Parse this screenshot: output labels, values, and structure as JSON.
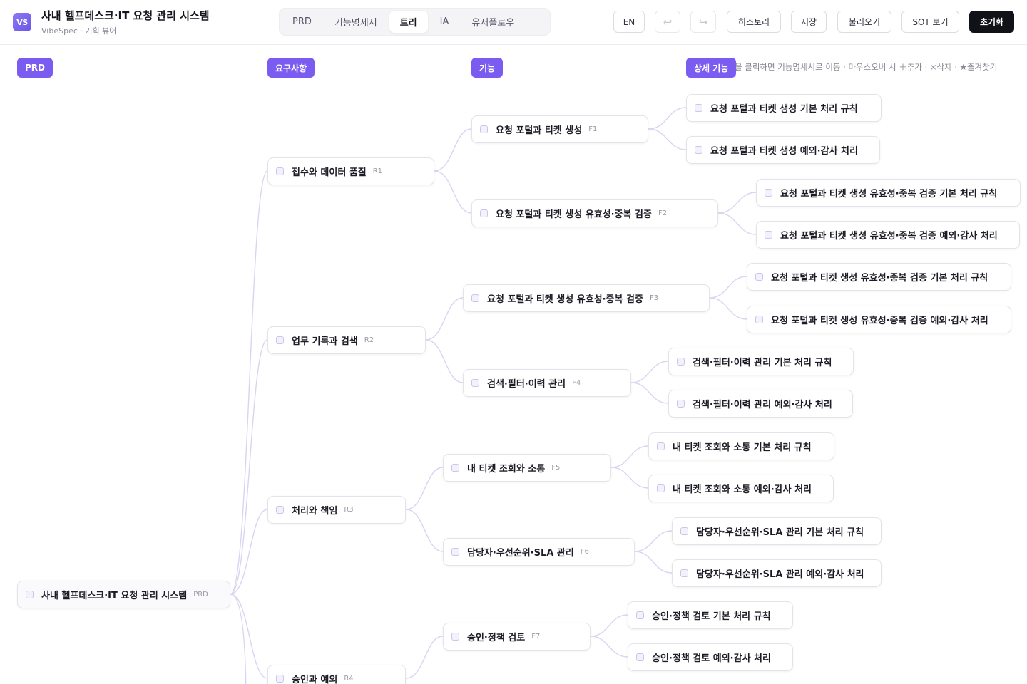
{
  "header": {
    "logo_text": "VS",
    "title": "사내 헬프데스크·IT 요청 관리 시스템",
    "subtitle": "VibeSpec · 기획 뷰어",
    "tabs": [
      {
        "label": "PRD"
      },
      {
        "label": "기능명세서"
      },
      {
        "label": "트리"
      },
      {
        "label": "IA"
      },
      {
        "label": "유저플로우"
      }
    ],
    "active_tab": "트리",
    "buttons": {
      "lang": "EN",
      "undo": "↩",
      "redo": "↪",
      "history": "히스토리",
      "save": "저장",
      "load": "불러오기",
      "sot": "SOT 보기",
      "reset": "초기화"
    }
  },
  "tree": {
    "columns": {
      "prd": "PRD",
      "requirements": "요구사항",
      "features": "기능",
      "details": "상세 기능"
    },
    "hint": "을 클릭하면 기능명세서로 이동 · 마우스오버 시 ＋추가 · ×삭제 · ★즐겨찾기",
    "root": {
      "label": "사내 헬프데스크·IT 요청 관리 시스템",
      "code": "PRD"
    },
    "requirements": [
      {
        "label": "접수와 데이터 품질",
        "code": "R1"
      },
      {
        "label": "업무 기록과 검색",
        "code": "R2"
      },
      {
        "label": "처리와 책임",
        "code": "R3"
      },
      {
        "label": "승인과 예외",
        "code": "R4"
      }
    ],
    "features": [
      {
        "label": "요청 포털과 티켓 생성",
        "code": "F1"
      },
      {
        "label": "요청 포털과 티켓 생성 유효성·중복 검증",
        "code": "F2"
      },
      {
        "label": "요청 포털과 티켓 생성 유효성·중복 검증",
        "code": "F3"
      },
      {
        "label": "검색·필터·이력 관리",
        "code": "F4"
      },
      {
        "label": "내 티켓 조회와 소통",
        "code": "F5"
      },
      {
        "label": "담당자·우선순위·SLA 관리",
        "code": "F6"
      },
      {
        "label": "승인·정책 검토",
        "code": "F7"
      }
    ],
    "details": [
      {
        "label": "요청 포털과 티켓 생성 기본 처리 규칙"
      },
      {
        "label": "요청 포털과 티켓 생성 예외·감사 처리"
      },
      {
        "label": "요청 포털과 티켓 생성 유효성·중복 검증 기본 처리 규칙"
      },
      {
        "label": "요청 포털과 티켓 생성 유효성·중복 검증 예외·감사 처리"
      },
      {
        "label": "요청 포털과 티켓 생성 유효성·중복 검증 기본 처리 규칙"
      },
      {
        "label": "요청 포털과 티켓 생성 유효성·중복 검증 예외·감사 처리"
      },
      {
        "label": "검색·필터·이력 관리 기본 처리 규칙"
      },
      {
        "label": "검색·필터·이력 관리 예외·감사 처리"
      },
      {
        "label": "내 티켓 조회와 소통 기본 처리 규칙"
      },
      {
        "label": "내 티켓 조회와 소통 예외·감사 처리"
      },
      {
        "label": "담당자·우선순위·SLA 관리 기본 처리 규칙"
      },
      {
        "label": "담당자·우선순위·SLA 관리 예외·감사 처리"
      },
      {
        "label": "승인·정책 검토 기본 처리 규칙"
      },
      {
        "label": "승인·정책 검토 예외·감사 처리"
      }
    ]
  }
}
